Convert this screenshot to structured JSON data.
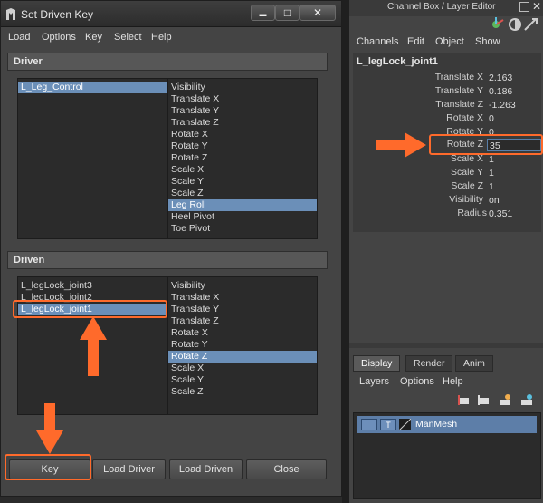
{
  "set_driven_key": {
    "title": "Set Driven Key",
    "window_buttons": {
      "minimize": "▬",
      "maximize": "□",
      "close": "✕"
    },
    "menu": [
      "Load",
      "Options",
      "Key",
      "Select",
      "Help"
    ],
    "driver": {
      "header": "Driver",
      "objects": [
        {
          "label": "L_Leg_Control",
          "selected": true
        }
      ],
      "attributes": [
        {
          "label": "Visibility"
        },
        {
          "label": "Translate X"
        },
        {
          "label": "Translate Y"
        },
        {
          "label": "Translate Z"
        },
        {
          "label": "Rotate X"
        },
        {
          "label": "Rotate Y"
        },
        {
          "label": "Rotate Z"
        },
        {
          "label": "Scale X"
        },
        {
          "label": "Scale Y"
        },
        {
          "label": "Scale Z"
        },
        {
          "label": "Leg Roll",
          "selected": true
        },
        {
          "label": "Heel Pivot"
        },
        {
          "label": "Toe Pivot"
        }
      ]
    },
    "driven": {
      "header": "Driven",
      "objects": [
        {
          "label": "L_legLock_joint3"
        },
        {
          "label": "L_legLock_joint2"
        },
        {
          "label": "L_legLock_joint1",
          "selected": true
        }
      ],
      "attributes": [
        {
          "label": "Visibility"
        },
        {
          "label": "Translate X"
        },
        {
          "label": "Translate Y"
        },
        {
          "label": "Translate Z"
        },
        {
          "label": "Rotate X"
        },
        {
          "label": "Rotate Y"
        },
        {
          "label": "Rotate Z",
          "selected": true
        },
        {
          "label": "Scale X"
        },
        {
          "label": "Scale Y"
        },
        {
          "label": "Scale Z"
        }
      ]
    },
    "buttons": {
      "key": "Key",
      "load_driver": "Load Driver",
      "load_driven": "Load Driven",
      "close": "Close"
    }
  },
  "channel_box": {
    "title": "Channel Box / Layer Editor",
    "menu": [
      "Channels",
      "Edit",
      "Object",
      "Show"
    ],
    "object_name": "L_legLock_joint1",
    "attributes": [
      {
        "name": "Translate X",
        "value": "2.163"
      },
      {
        "name": "Translate Y",
        "value": "0.186"
      },
      {
        "name": "Translate Z",
        "value": "-1.263"
      },
      {
        "name": "Rotate X",
        "value": "0"
      },
      {
        "name": "Rotate Y",
        "value": "0"
      },
      {
        "name": "Rotate Z",
        "value": "35",
        "editing": true
      },
      {
        "name": "Scale X",
        "value": "1"
      },
      {
        "name": "Scale Y",
        "value": "1"
      },
      {
        "name": "Scale Z",
        "value": "1"
      },
      {
        "name": "Visibility",
        "value": "on"
      },
      {
        "name": "Radius",
        "value": "0.351"
      }
    ]
  },
  "layer_editor": {
    "tabs": [
      {
        "label": "Display",
        "active": true
      },
      {
        "label": "Render"
      },
      {
        "label": "Anim"
      }
    ],
    "menu": [
      "Layers",
      "Options",
      "Help"
    ],
    "layers": [
      {
        "visible": "V",
        "type": "T",
        "name": "ManMesh"
      }
    ]
  },
  "colors": {
    "accent_orange": "#ff6a2b",
    "selection_blue": "#6b8fb8",
    "panel": "#444444",
    "list_bg": "#2b2b2b"
  },
  "icons": [
    "maya-app-icon",
    "minimize-icon",
    "maximize-icon",
    "close-icon",
    "dock-icon",
    "channel-box-tool-icons",
    "new-layer-icons"
  ]
}
